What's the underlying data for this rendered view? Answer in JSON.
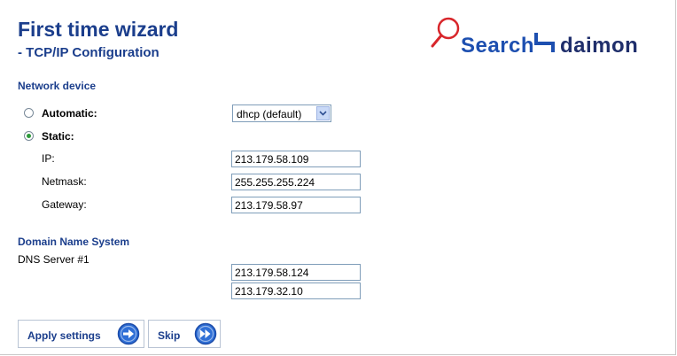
{
  "header": {
    "title": "First time wizard",
    "subtitle": "- TCP/IP Configuration"
  },
  "logo": {
    "part1": "Search",
    "part2": "daimon"
  },
  "network": {
    "section_title": "Network device",
    "automatic_label": "Automatic:",
    "static_label": "Static:",
    "selected_mode": "static",
    "dhcp_selected": "dhcp (default)",
    "ip_label": "IP:",
    "ip_value": "213.179.58.109",
    "netmask_label": "Netmask:",
    "netmask_value": "255.255.255.224",
    "gateway_label": "Gateway:",
    "gateway_value": "213.179.58.97"
  },
  "dns": {
    "section_title": "Domain Name System",
    "server_label": "DNS Server #1",
    "server1": "213.179.58.124",
    "server2": "213.179.32.10"
  },
  "actions": {
    "apply_label": "Apply settings",
    "skip_label": "Skip"
  },
  "colors": {
    "heading": "#1b3e8c",
    "radio_dot": "#2d9a3a",
    "button_icon": "#2f6fd6"
  },
  "icons": {
    "apply": "arrow-right-circle-icon",
    "skip": "fast-forward-circle-icon",
    "logo": "magnifier-icon"
  }
}
